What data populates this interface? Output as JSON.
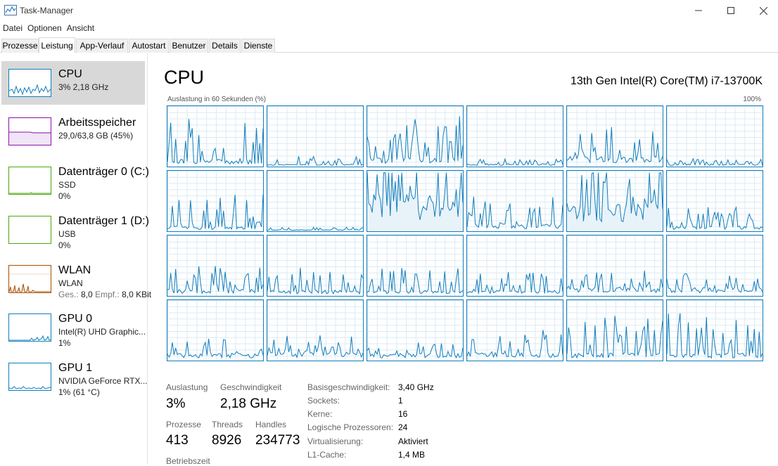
{
  "window": {
    "title": "Task-Manager"
  },
  "menu": [
    "Datei",
    "Optionen",
    "Ansicht"
  ],
  "tabs": [
    "Prozesse",
    "Leistung",
    "App-Verlauf",
    "Autostart",
    "Benutzer",
    "Details",
    "Dienste"
  ],
  "active_tab": "Leistung",
  "sidebar": [
    {
      "title": "CPU",
      "line1": "3%  2,18 GHz",
      "color": "#117dbb",
      "selected": true
    },
    {
      "title": "Arbeitsspeicher",
      "line1": "29,0/63,8 GB (45%)",
      "color": "#8b12ae"
    },
    {
      "title": "Datenträger 0 (C:)",
      "line1": "SSD",
      "line2": "0%",
      "color": "#4da60c"
    },
    {
      "title": "Datenträger 1 (D:)",
      "line1": "USB",
      "line2": "0%",
      "color": "#4da60c"
    },
    {
      "title": "WLAN",
      "line1": "WLAN",
      "line2_muted_a": "Ges.:",
      "line2_val_a": "8,0",
      "line2_muted_b": "Empf.:",
      "line2_val_b": "8,0 KBit",
      "color": "#a74f01"
    },
    {
      "title": "GPU 0",
      "line1": "Intel(R) UHD Graphic...",
      "line2": "1%",
      "color": "#117dbb"
    },
    {
      "title": "GPU 1",
      "line1": "NVIDIA GeForce RTX...",
      "line2": "1%  (61 °C)",
      "color": "#117dbb"
    }
  ],
  "main": {
    "title": "CPU",
    "model": "13th Gen Intel(R) Core(TM) i7-13700K",
    "graph_label": "Auslastung in 60 Sekunden (%)",
    "graph_max": "100%",
    "graph_color": "#117dbb",
    "logical_processor_graphs": 24
  },
  "stats": {
    "auslastung_label": "Auslastung",
    "auslastung_value": "3%",
    "geschwindigkeit_label": "Geschwindigkeit",
    "geschwindigkeit_value": "2,18 GHz",
    "prozesse_label": "Prozesse",
    "prozesse_value": "413",
    "threads_label": "Threads",
    "threads_value": "8926",
    "handles_label": "Handles",
    "handles_value": "234773",
    "betriebszeit_label": "Betriebszeit"
  },
  "specs": [
    {
      "key": "Basisgeschwindigkeit:",
      "value": "3,40 GHz"
    },
    {
      "key": "Sockets:",
      "value": "1"
    },
    {
      "key": "Kerne:",
      "value": "16"
    },
    {
      "key": "Logische Prozessoren:",
      "value": "24"
    },
    {
      "key": "Virtualisierung:",
      "value": "Aktiviert"
    },
    {
      "key": "L1-Cache:",
      "value": "1,4 MB"
    }
  ]
}
